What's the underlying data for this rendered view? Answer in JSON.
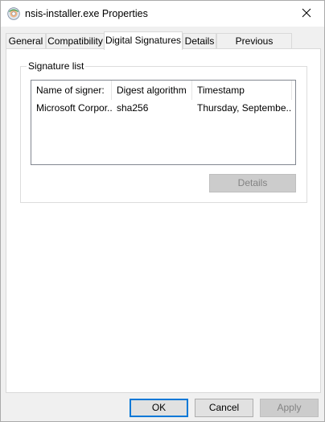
{
  "window": {
    "title": "nsis-installer.exe Properties",
    "icon": "installer-disc-icon"
  },
  "tabs": [
    {
      "label": "General",
      "active": false
    },
    {
      "label": "Compatibility",
      "active": false
    },
    {
      "label": "Digital Signatures",
      "active": true
    },
    {
      "label": "Details",
      "active": false
    },
    {
      "label": "Previous Versions",
      "active": false
    }
  ],
  "signature_list": {
    "label": "Signature list",
    "columns": [
      "Name of signer:",
      "Digest algorithm",
      "Timestamp"
    ],
    "rows": [
      {
        "signer": "Microsoft Corpor...",
        "digest": "sha256",
        "timestamp": "Thursday, Septembe..."
      }
    ],
    "details_label": "Details",
    "details_enabled": false
  },
  "buttons": {
    "ok": "OK",
    "cancel": "Cancel",
    "apply": "Apply",
    "apply_enabled": false
  },
  "colors": {
    "accent": "#0078d7",
    "disabled_text": "#838383"
  }
}
